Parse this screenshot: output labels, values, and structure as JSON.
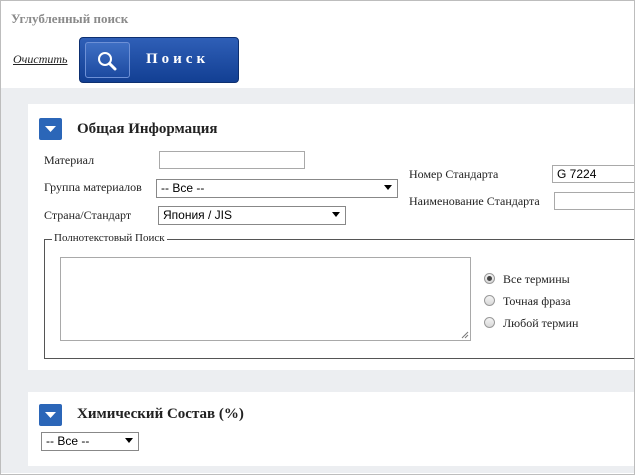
{
  "header": {
    "title": "Углубленный поиск",
    "clear_label": "Очистить",
    "search_label": "Поиск"
  },
  "general": {
    "section_title": "Общая Информация",
    "material_label": "Материал",
    "material_value": "",
    "material_group_label": "Группа материалов",
    "material_group_value": "-- Все --",
    "country_label": "Страна/Стандарт",
    "country_value": "Япония / JIS",
    "standard_number_label": "Номер Стандарта",
    "standard_number_value": "G 7224",
    "standard_name_label": "Наименование Стандарта",
    "standard_name_value": ""
  },
  "fulltext": {
    "legend": "Полнотекстовый Поиск",
    "value": "",
    "options": [
      {
        "label": "Все термины",
        "checked": true
      },
      {
        "label": "Точная фраза",
        "checked": false
      },
      {
        "label": "Любой термин",
        "checked": false
      }
    ]
  },
  "chemical": {
    "section_title": "Химический Состав (%)",
    "select_value": "-- Все --"
  },
  "colors": {
    "accent": "#2b66b8",
    "button": "#1a4a9e",
    "band": "#eceef1",
    "title_grey": "#8a8a8a"
  }
}
